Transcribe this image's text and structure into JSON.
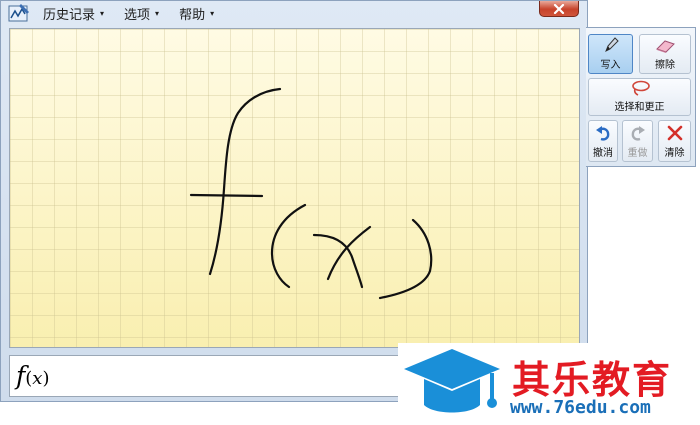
{
  "menu": {
    "history_label": "历史记录",
    "options_label": "选项",
    "help_label": "帮助",
    "caret": "▾"
  },
  "tools": {
    "write_label": "写入",
    "erase_label": "擦除",
    "select_correct_label": "选择和更正",
    "undo_label": "撤消",
    "redo_label": "重做",
    "clear_label": "清除"
  },
  "preview": {
    "func": "f",
    "open_paren": "(",
    "arg": "x",
    "close_paren": ")"
  },
  "logo": {
    "name": "其乐教育",
    "url": "www.76edu.com"
  },
  "colors": {
    "logo_red": "#e31b23",
    "logo_blue": "#1a6fb8",
    "ink": "#111111",
    "pad_yellow": "#fdf6c9"
  }
}
